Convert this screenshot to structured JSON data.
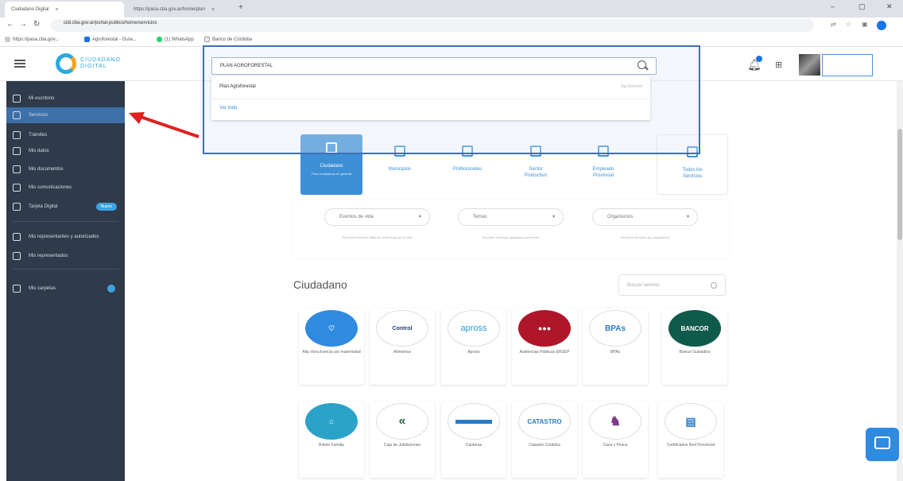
{
  "browser": {
    "tabs": [
      {
        "title": "Ciudadano Digital"
      },
      {
        "title": "https://pasa.cba.gov.ar/home/plan"
      }
    ],
    "url": "cidi.cba.gov.ar/portal-publico/home/servicios",
    "bookmarks": [
      "https://pasa.cba.gov...",
      "Agroforestal - Guía...",
      "(1) WhatsApp",
      "Banco de Córdoba"
    ]
  },
  "header": {
    "logo_text_1": "CIUDADANO",
    "logo_text_2": "DIGITAL"
  },
  "sidebar": {
    "items": [
      {
        "label": "Mi escritorio"
      },
      {
        "label": "Servicios"
      },
      {
        "label": "Trámites"
      },
      {
        "label": "Mis datos"
      },
      {
        "label": "Mis documentos"
      },
      {
        "label": "Mis comunicaciones"
      },
      {
        "label": "Tarjeta Digital",
        "badge": "Nuevo"
      },
      {
        "label": "Mis representantes y autorizados"
      },
      {
        "label": "Mis representados"
      },
      {
        "label": "Mis carpetas"
      }
    ]
  },
  "search": {
    "value": "PLAN AGROFORESTAL",
    "suggestion": "Plan Agroforestal",
    "suggestion_tag": "Agroforestal",
    "see_all": "Ver todo"
  },
  "categories": [
    {
      "label": "Ciudadano",
      "sub": "Para ciudadanos en general"
    },
    {
      "label": "Municipios"
    },
    {
      "label": "Profesionales"
    },
    {
      "label": "Sector Productivo"
    },
    {
      "label": "Empleado Provincial"
    },
    {
      "label": "Todos los Servicios"
    }
  ],
  "filters": [
    {
      "label": "Eventos de vida",
      "help": "Encontrá servicios útiles en cada etapa de tu vida"
    },
    {
      "label": "Temas",
      "help": "Encontrá servicios agrupados por temas"
    },
    {
      "label": "Organismos",
      "help": "Servicios ofrecidos por organismos"
    }
  ],
  "section": {
    "title": "Ciudadano",
    "search_placeholder": "Buscar servicio"
  },
  "cards_row1": [
    {
      "label": "Alta Vera licencia por maternidad",
      "logo": ""
    },
    {
      "label": "Alimentos",
      "logo": "Control"
    },
    {
      "label": "Apross",
      "logo": "apross"
    },
    {
      "label": "Audiencias Públicas ERSEP",
      "logo": ""
    },
    {
      "label": "BPAs",
      "logo": "BPAs"
    },
    {
      "label": "Bancor Subsidios",
      "logo": "BANCOR"
    }
  ],
  "cards_row2": [
    {
      "label": "Boleto Familia",
      "logo": ""
    },
    {
      "label": "Caja de Jubilaciones",
      "logo": ""
    },
    {
      "label": "Canteras",
      "logo": ""
    },
    {
      "label": "Catastro Córdoba",
      "logo": "CATASTRO"
    },
    {
      "label": "Caza y Pesca",
      "logo": ""
    },
    {
      "label": "Certificados Red Provincial",
      "logo": ""
    }
  ],
  "colors": {
    "primary": "#3d8fd6",
    "sidebar_bg": "#2f3a4a",
    "highlight_border": "#3f6fb5",
    "arrow": "#e02020"
  }
}
